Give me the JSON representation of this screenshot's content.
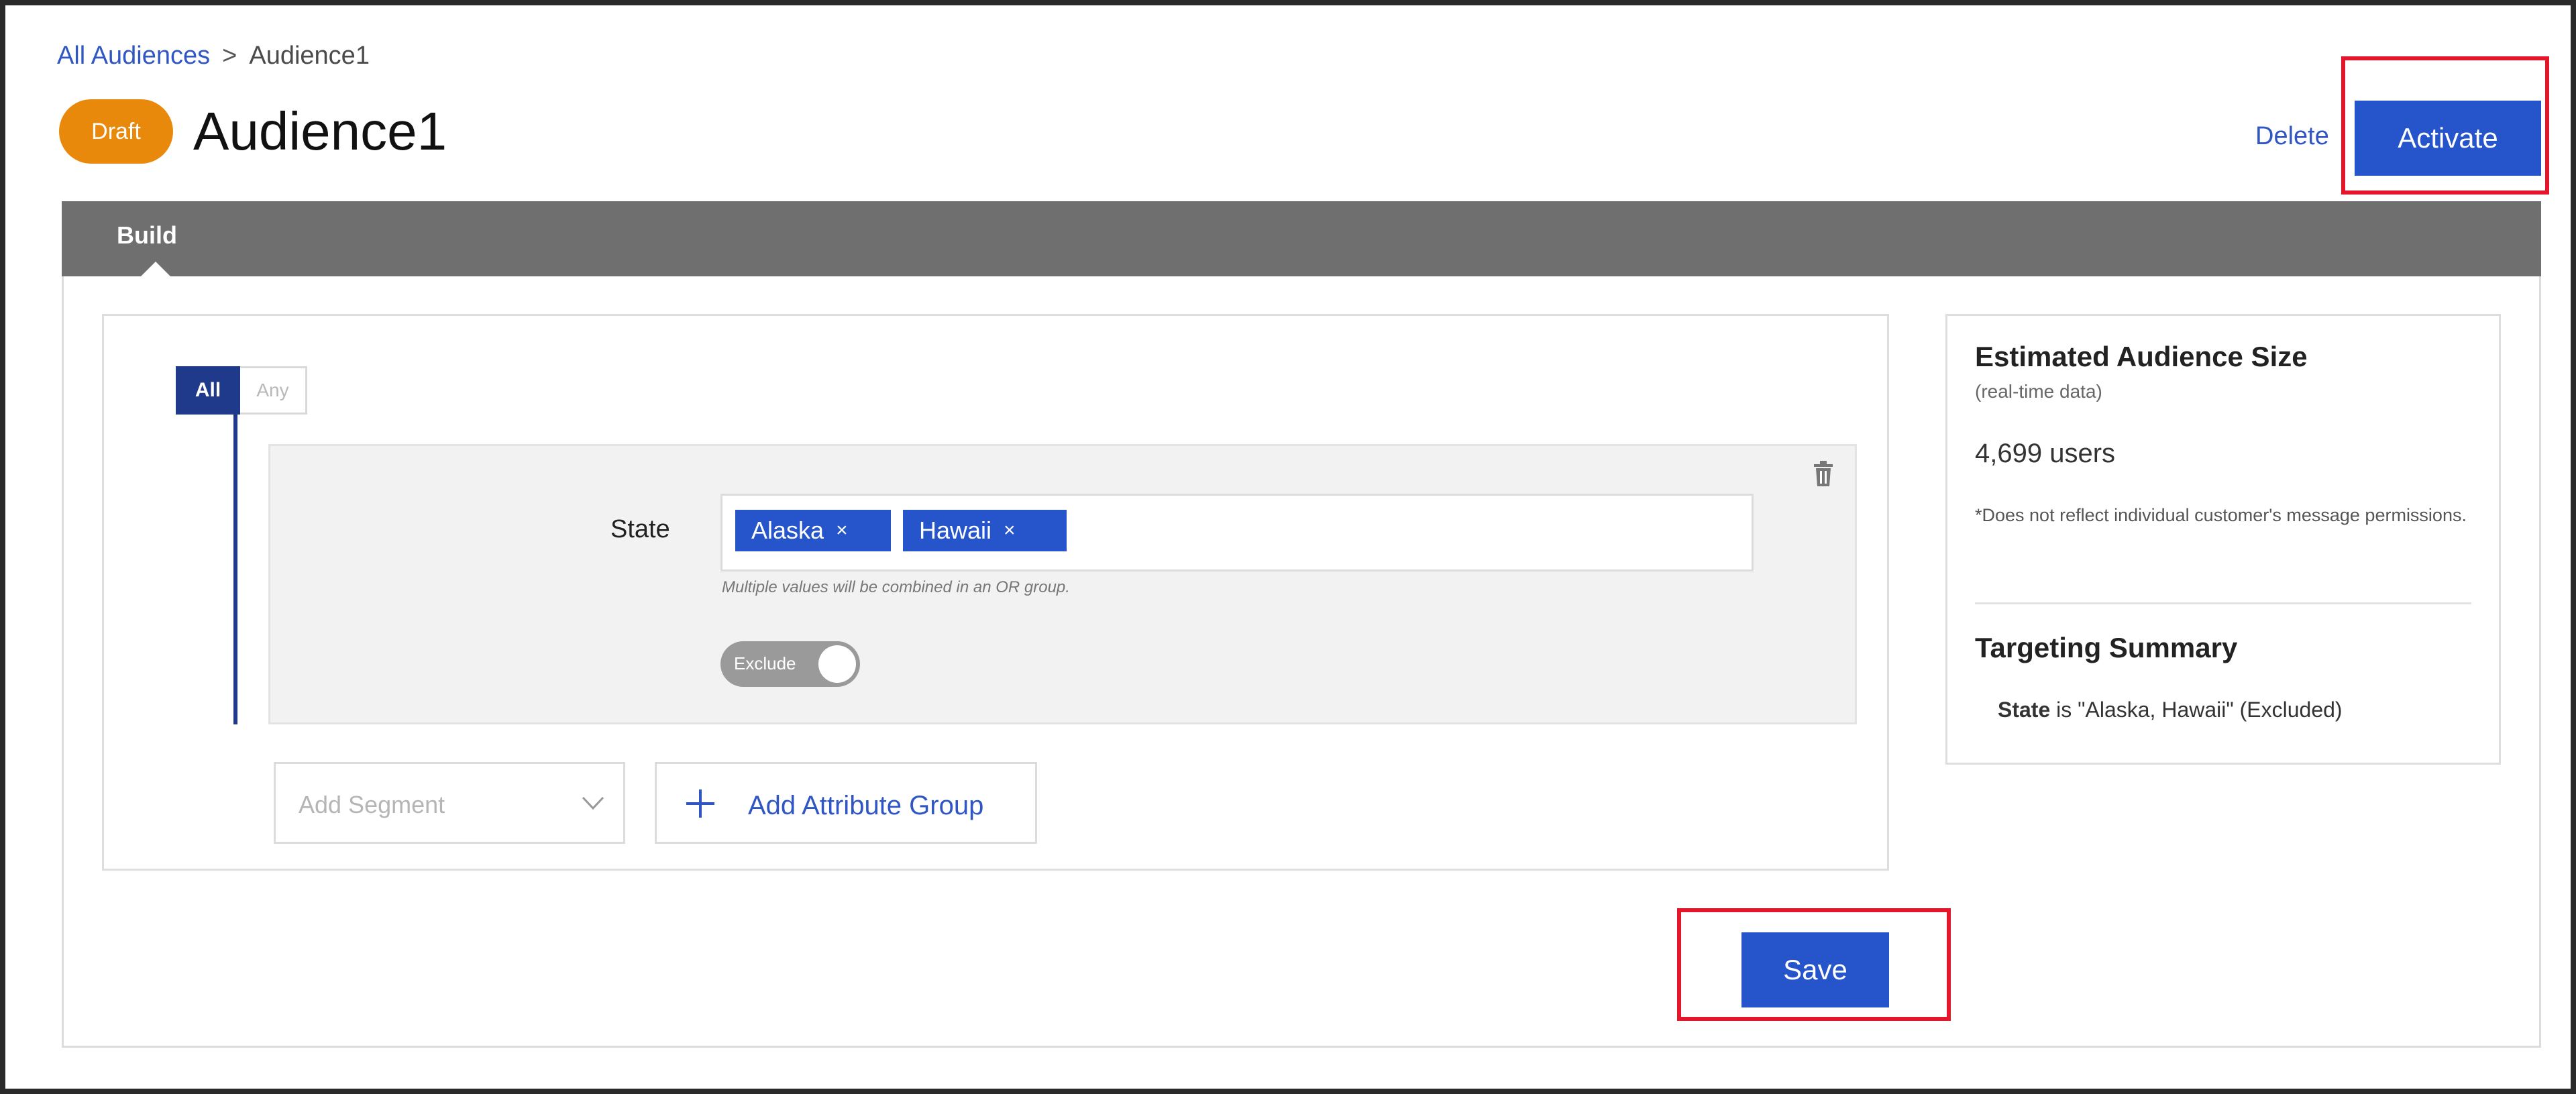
{
  "breadcrumb": {
    "link": "All Audiences",
    "separator": ">",
    "current": "Audience1"
  },
  "header": {
    "status_badge": "Draft",
    "title": "Audience1",
    "delete_label": "Delete",
    "activate_label": "Activate"
  },
  "tabs": [
    {
      "label": "Build",
      "active": true
    }
  ],
  "builder": {
    "match_all_label": "All",
    "match_any_label": "Any",
    "match_selected": "All",
    "condition": {
      "attribute_label": "State",
      "values": [
        "Alaska",
        "Hawaii"
      ],
      "remove_glyph": "×",
      "helper_text": "Multiple values will be combined in an OR group.",
      "exclude_label": "Exclude",
      "exclude_on": true
    },
    "add_segment_placeholder": "Add Segment",
    "add_group_label": "Add Attribute Group"
  },
  "summary": {
    "size_title": "Estimated Audience Size",
    "size_subtitle": "(real-time data)",
    "user_count": "4,699 users",
    "note": "*Does not reflect individual customer's message permissions.",
    "targeting_title": "Targeting Summary",
    "targeting_key": "State",
    "targeting_text": " is \"Alaska, Hawaii\" (Excluded)"
  },
  "footer": {
    "save_label": "Save"
  },
  "icons": {
    "trash": "trash-icon",
    "chevron": "chevron-down-icon",
    "plus": "plus-icon",
    "close": "close-icon"
  },
  "colors": {
    "primary": "#2554cb",
    "draft": "#e8890c",
    "highlight": "#e3162b",
    "tabbar": "#6f6f6f",
    "group": "#1f3a8a"
  }
}
